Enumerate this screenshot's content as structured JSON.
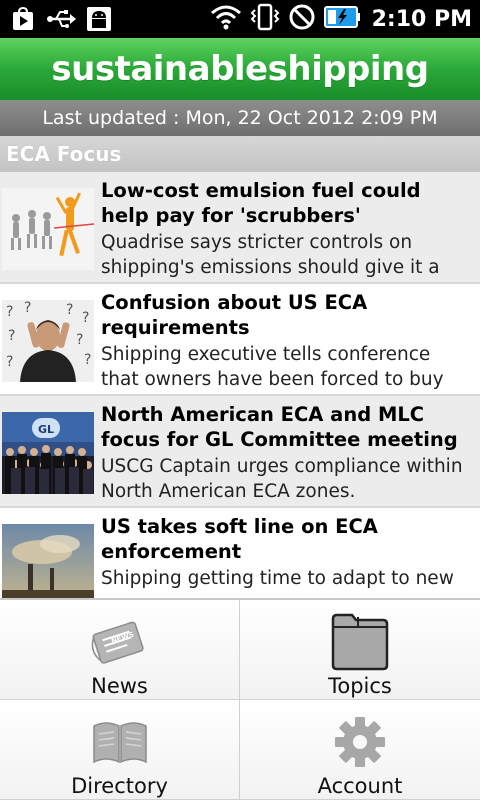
{
  "status_bar": {
    "time": "2:10 PM",
    "left_icons": [
      "play-store-icon",
      "usb-icon",
      "android-debug-icon"
    ],
    "right_icons": [
      "wifi-icon",
      "vibrate-icon",
      "no-signal-icon",
      "battery-charging-icon"
    ]
  },
  "header": {
    "brand": "sustainableshipping",
    "last_updated": "Last updated : Mon, 22 Oct 2012  2:09 PM",
    "section": "ECA Focus"
  },
  "articles": [
    {
      "title": "Low-cost emulsion fuel could help pay for 'scrubbers'",
      "desc": "Quadrise says stricter controls on shipping's emissions should give it a"
    },
    {
      "title": "Confusion about US ECA requirements",
      "desc": "Shipping executive tells conference that owners have been forced to buy marine"
    },
    {
      "title": "North American ECA and MLC focus for GL Committee meeting",
      "desc": "USCG Captain urges compliance within North American ECA zones."
    },
    {
      "title": "US takes soft line on ECA enforcement",
      "desc": "Shipping getting time to adapt to new"
    }
  ],
  "menu": {
    "news": "News",
    "topics": "Topics",
    "directory": "Directory",
    "account": "Account"
  },
  "colors": {
    "brand_green": "#2aa838",
    "updated_gray": "#7a7a7a",
    "section_gray": "#cfcfcf"
  }
}
